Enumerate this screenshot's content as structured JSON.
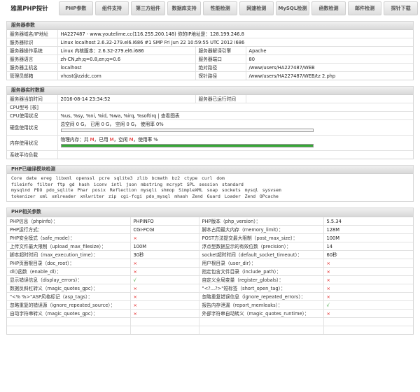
{
  "nav": {
    "brand": "雅黑PHP探针",
    "tabs": [
      "PHP参数",
      "组件支持",
      "第三方组件",
      "数据库支持",
      "性能检测",
      "网速检测",
      "MySQL检测",
      "函数检测",
      "邮件检测",
      "探针下载"
    ]
  },
  "server_params": {
    "title": "服务器参数",
    "domain_label": "服务器域名/IP地址",
    "domain_value": "HA227487 - www.youtelime.cc(116.255.200.148)  你的IP地址是：128.199.246.8",
    "id_label": "服务器标识",
    "id_value": "Linux localhost 2.6.32-279.el6.i686 #1 SMP Fri Jun 22 10:59:55 UTC 2012 i686",
    "os_label": "服务器操作系统",
    "os_value": "Linux  内核版本：2.6.32-279.el6.i686",
    "engine_label": "服务器解译引擎",
    "engine_value": "Apache",
    "lang_label": "服务器语言",
    "lang_value": "zh-CN,zh;q=0.8,en;q=0.6",
    "port_label": "服务器端口",
    "port_value": "80",
    "host_label": "服务器主机名",
    "host_value": "localhost",
    "abspath_label": "绝对路径",
    "abspath_value": "/www/users/HA227487/WEB",
    "admin_label": "管理员邮箱",
    "admin_value": "vhost@zzidc.com",
    "probe_label": "探针路径",
    "probe_value": "/www/users/HA227487/WEB/tz 2.php"
  },
  "realtime": {
    "title": "服务器实时数据",
    "time_label": "服务器当前时间",
    "time_value": "2016-08-14 23:34:52",
    "uptime_label": "服务器已运行时间",
    "uptime_value": "",
    "cpu_model_label": "CPU型号 [核]",
    "cpu_model_value": "",
    "cpu_usage_label": "CPU使用状况",
    "cpu_usage_value": "%us, %sy, %ni, %id, %wa, %irq, %softirq",
    "cpu_usage_link": "| 查看图表",
    "disk_label": "硬盘使用状况",
    "disk_text": "总空间 0 G，  已用 0 G，  空闲 0 G，  使用率 0%",
    "disk_percent": 0,
    "mem_label": "内存使用状况",
    "mem_text_a": "物理内存：共 ",
    "mem_m1": "M",
    "mem_text_b": "，已用 ",
    "mem_m2": "M",
    "mem_text_c": "，空闲 ",
    "mem_m3": "M",
    "mem_text_d": "，使用率 %",
    "mem_percent": 100,
    "load_label": "系统平均负载",
    "load_value": ""
  },
  "modules": {
    "title": "PHP已编译模块检测",
    "line1": "Core  date  ereg  libxml  openssl  pcre  sqlite3  zlib  bcmath  bz2  ctype  curl  dom",
    "line2": "fileinfo  filter  ftp  gd  hash  iconv  intl  json  mbstring  mcrypt  SPL  session  standard",
    "line3": "mysqlnd  PDO  pdo_sqlite  Phar  posix  Reflection  mysqli  shmop  SimpleXML  soap  sockets  mysql  sysvsem",
    "line4": "tokenizer  xml  xmlreader  xmlwriter  zip  cgi-fcgi  pdo_mysql  mhash  Zend Guard Loader  Zend OPcache"
  },
  "php_params": {
    "title": "PHP相关参数",
    "rows": [
      {
        "l1": "PHP信息（phpinfo）：",
        "v1": "PHPINFO",
        "l2": "PHP版本（php_version）：",
        "v2": "5.5.34"
      },
      {
        "l1": "PHP运行方式：",
        "v1": "CGI-FCGI",
        "l2": "脚本占用最大内存（memory_limit）：",
        "v2": "128M"
      },
      {
        "l1": "PHP安全模式（safe_mode）：",
        "v1": "×",
        "l2": "POST方法提交最大限制（post_max_size）：",
        "v2": "100M"
      },
      {
        "l1": "上传文件最大限制（upload_max_filesize）：",
        "v1": "100M",
        "l2": "浮点型数据显示的有效位数（precision）：",
        "v2": "14"
      },
      {
        "l1": "脚本超时时间（max_execution_time）：",
        "v1": "30秒",
        "l2": "socket超时时间（default_socket_timeout）：",
        "v2": "60秒"
      },
      {
        "l1": "PHP页面根目录（doc_root）：",
        "v1": "×",
        "l2": "用户根目录（user_dir）：",
        "v2": "×"
      },
      {
        "l1": "dl()函数（enable_dl）：",
        "v1": "×",
        "l2": "指定包含文件目录（include_path）：",
        "v2": "×"
      },
      {
        "l1": "显示错误信息（display_errors）：",
        "v1": "√",
        "l2": "自定义全局变量（register_globals）：",
        "v2": "×"
      },
      {
        "l1": "数据反斜杠转义（magic_quotes_gpc）：",
        "v1": "×",
        "l2": "\"<?...?>\"短标签（short_open_tag）：",
        "v2": "×"
      },
      {
        "l1": "\"<% %>\"ASP风格标记（asp_tags）：",
        "v1": "×",
        "l2": "忽略重复错误信息（ignore_repeated_errors）：",
        "v2": "×"
      },
      {
        "l1": "忽略重复的错误源（ignore_repeated_source）：",
        "v1": "×",
        "l2": "报告内存泄漏（report_memleaks）：",
        "v2": "√"
      },
      {
        "l1": "自动字符串转义（magic_quotes_gpc）：",
        "v1": "×",
        "l2": "外部字符串自动转义（magic_quotes_runtime）：",
        "v2": "×"
      },
      {
        "l1": "",
        "v1": "",
        "l2": "",
        "v2": ""
      },
      {
        "l1": "",
        "v1": "",
        "l2": "",
        "v2": ""
      }
    ]
  }
}
